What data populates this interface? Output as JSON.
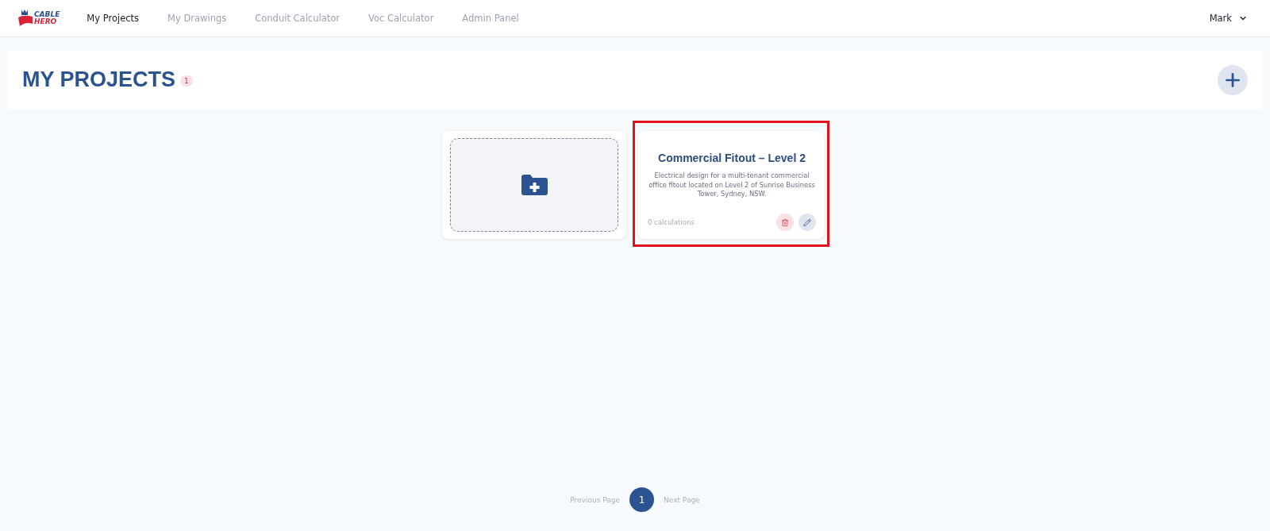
{
  "brand": {
    "line_1": "CABLE",
    "line_2": "HERO"
  },
  "nav": [
    {
      "label": "My Projects",
      "selected": true
    },
    {
      "label": "My Drawings",
      "selected": false
    },
    {
      "label": "Conduit Calculator",
      "selected": false
    },
    {
      "label": "Voc Calculator",
      "selected": false
    },
    {
      "label": "Admin Panel",
      "selected": false
    }
  ],
  "user": {
    "name": "Mark"
  },
  "page_header": {
    "title": "MY PROJECTS",
    "count": "1"
  },
  "projects": [
    {
      "title": "Commercial Fitout – Level 2",
      "description": "Electrical design for a multi-tenant commercial office fitout located on Level 2 of Sunrise Business Tower, Sydney, NSW.",
      "calculations": "0 calculations",
      "highlighted": true
    }
  ],
  "pagination": {
    "previous": "Previous Page",
    "pages": [
      {
        "label": "1",
        "selected": true
      }
    ],
    "next": "Next Page"
  }
}
